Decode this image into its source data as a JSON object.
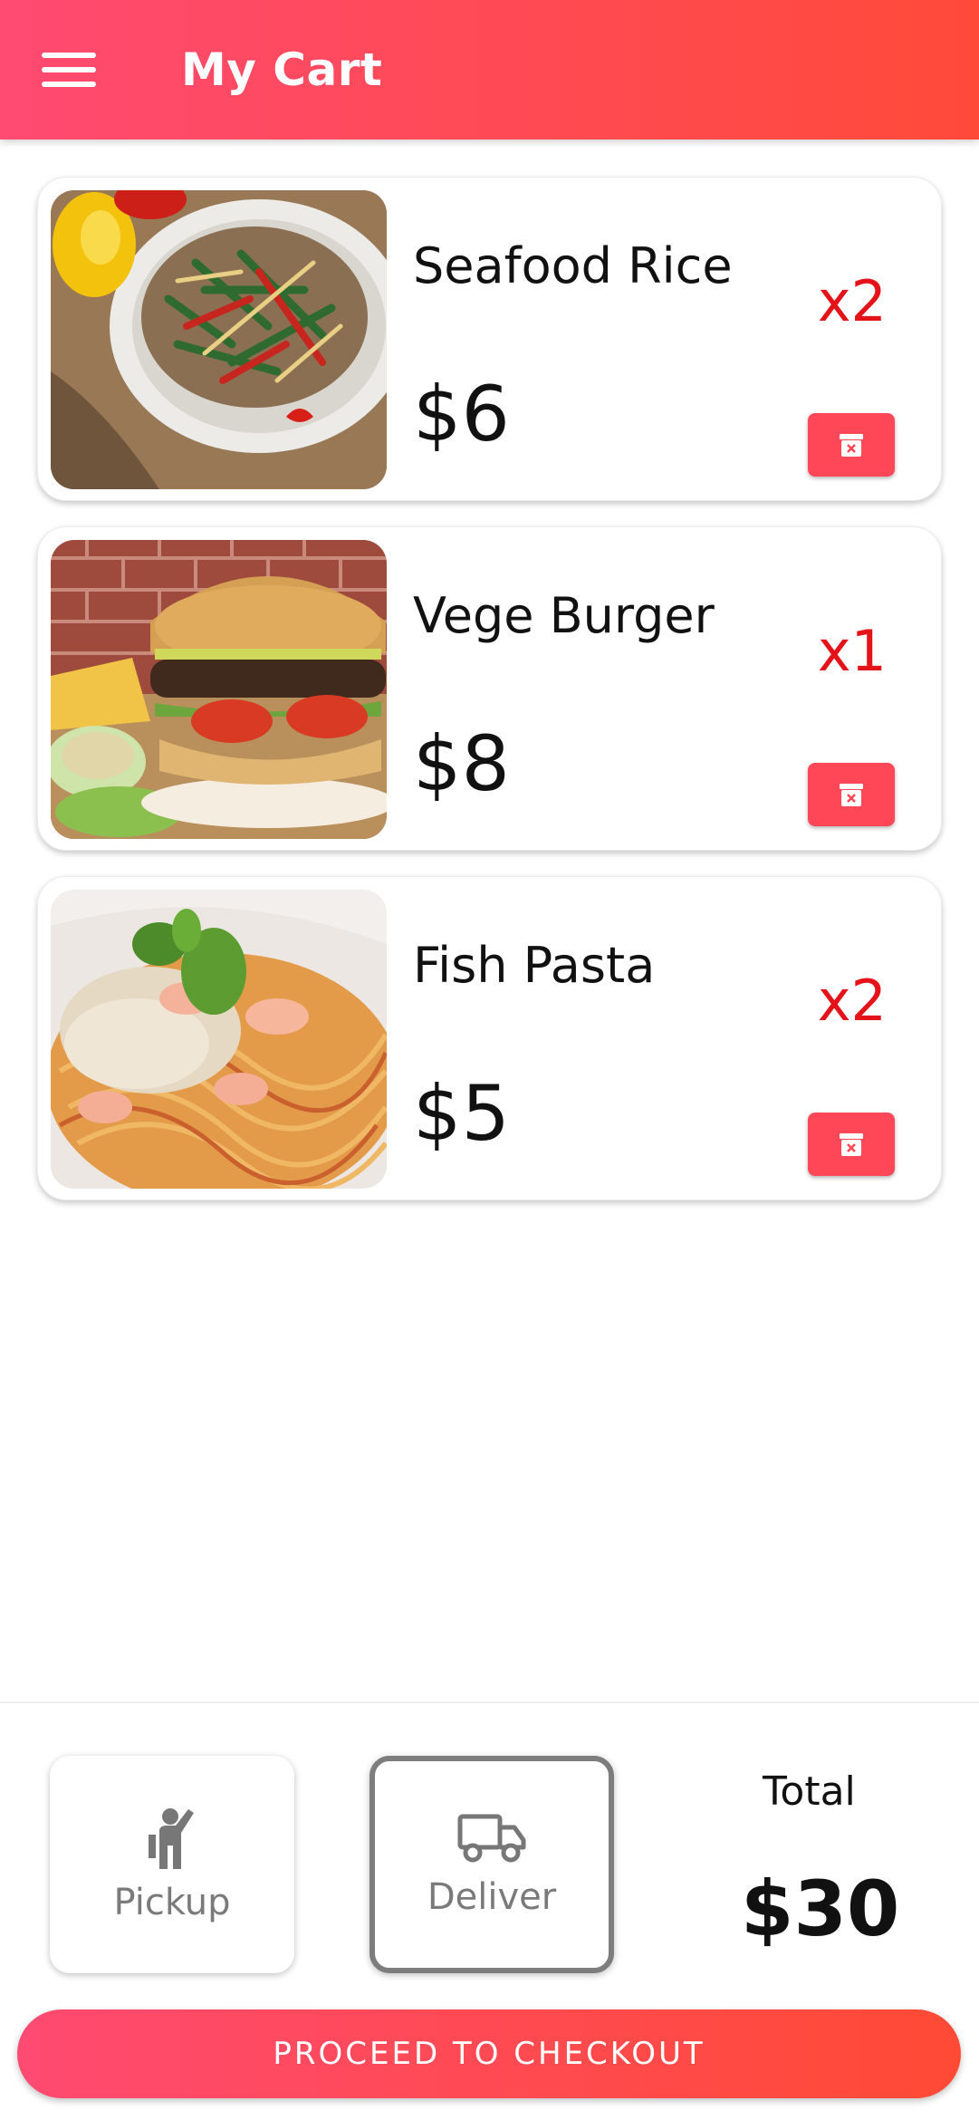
{
  "appbar": {
    "title": "My Cart",
    "menu_icon": "menu-icon",
    "gradient": [
      "#ff4a72",
      "#ff4a3a"
    ]
  },
  "cart": {
    "items": [
      {
        "name": "Seafood Rice",
        "price": "$6",
        "qty": "x2",
        "image": "seafood-rice-photo",
        "delete_icon": "trash-icon"
      },
      {
        "name": "Vege Burger",
        "price": "$8",
        "qty": "x1",
        "image": "vege-burger-photo",
        "delete_icon": "trash-icon"
      },
      {
        "name": "Fish Pasta",
        "price": "$5",
        "qty": "x2",
        "image": "fish-pasta-photo",
        "delete_icon": "trash-icon"
      }
    ]
  },
  "options": {
    "pickup": {
      "label": "Pickup",
      "icon": "person-waving-icon",
      "selected": false
    },
    "deliver": {
      "label": "Deliver",
      "icon": "truck-icon",
      "selected": true
    }
  },
  "total": {
    "label": "Total",
    "value": "$30"
  },
  "checkout": {
    "label": "PROCEED TO CHECKOUT"
  },
  "colors": {
    "accent": "#ff4757",
    "qty": "#e4131a",
    "selected_border": "#7d7d7d"
  }
}
